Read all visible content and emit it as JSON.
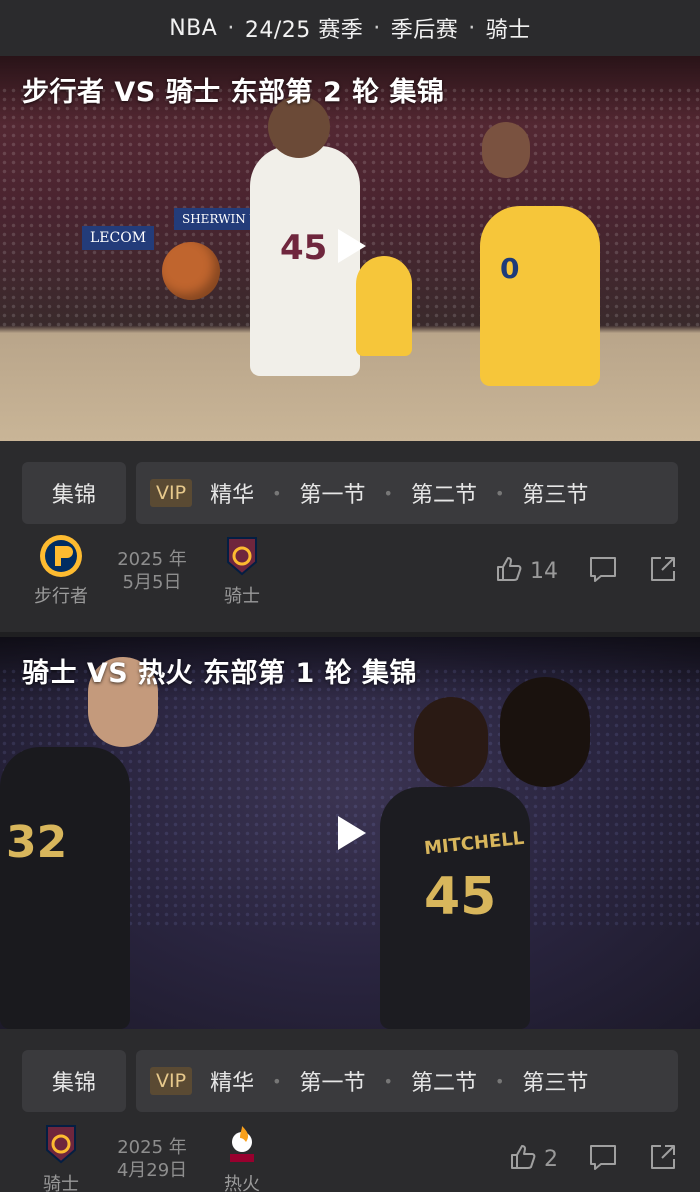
{
  "header": {
    "crumbs": [
      "NBA",
      "24/25 赛季",
      "季后赛",
      "骑士"
    ],
    "separator": "·"
  },
  "cards": [
    {
      "title": "步行者 VS 骑士 东部第 2 轮 集锦",
      "thumb_banners": [
        "LECOM",
        "SHERWIN WILLIAMS"
      ],
      "jersey_numbers": [
        "45",
        "0"
      ],
      "tags": {
        "main": "集锦",
        "vip": "VIP",
        "items": [
          "精华",
          "第一节",
          "第二节",
          "第三节"
        ]
      },
      "home_team": "步行者",
      "date_line1": "2025 年",
      "date_line2": "5月5日",
      "away_team": "骑士",
      "likes": "14"
    },
    {
      "title": "骑士 VS 热火 东部第 1 轮 集锦",
      "thumb_banners": [],
      "jersey_numbers": [
        "32",
        "45"
      ],
      "jersey_name": "MITCHELL",
      "tags": {
        "main": "集锦",
        "vip": "VIP",
        "items": [
          "精华",
          "第一节",
          "第二节",
          "第三节"
        ]
      },
      "home_team": "骑士",
      "date_line1": "2025 年",
      "date_line2": "4月29日",
      "away_team": "热火",
      "likes": "2"
    }
  ],
  "colors": {
    "background": "#2b2b2d",
    "tag_bg": "#3a3a3d",
    "vip_bg": "#5a4a33",
    "vip_text": "#e7c98c",
    "pacers_navy": "#002d62",
    "pacers_gold": "#fdbb30",
    "cavs_wine": "#6f263d",
    "heat_red": "#98002e"
  },
  "icons": {
    "play": "play-icon",
    "like": "thumbs-up-icon",
    "comment": "comment-icon",
    "share": "share-icon"
  }
}
